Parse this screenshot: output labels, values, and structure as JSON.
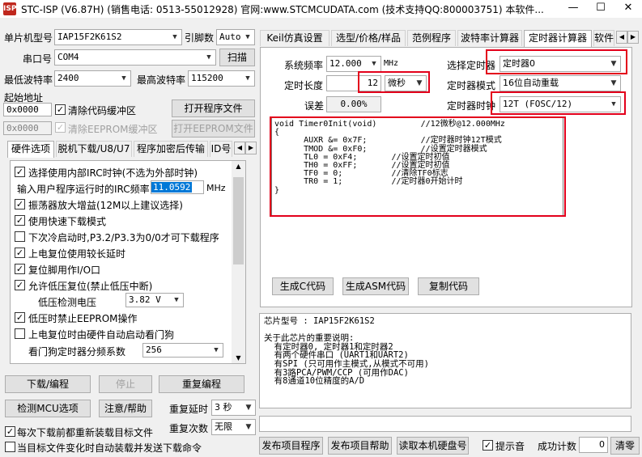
{
  "window": {
    "title": "STC-ISP (V6.87H) (销售电话: 0513-55012928) 官网:www.STCMCUDATA.com  (技术支持QQ:800003751) 本软件...",
    "minimize": "—",
    "maximize": "☐",
    "close": "✕"
  },
  "left": {
    "mcu_label": "单片机型号",
    "mcu_value": "IAP15F2K61S2",
    "pins_label": "引脚数",
    "pins_value": "Auto",
    "port_label": "串口号",
    "port_value": "COM4",
    "scan_button": "扫描",
    "min_baud_label": "最低波特率",
    "min_baud_value": "2400",
    "max_baud_label": "最高波特率",
    "max_baud_value": "115200",
    "start_addr_label": "起始地址",
    "addr1": "0x0000",
    "clear_code_label": "清除代码缓冲区",
    "open_program_button": "打开程序文件",
    "addr2": "0x0000",
    "clear_eeprom_label": "清除EEPROM缓冲区",
    "open_eeprom_button": "打开EEPROM文件",
    "tabs": [
      "硬件选项",
      "脱机下载/U8/U7",
      "程序加密后传输",
      "ID号"
    ],
    "options": [
      {
        "text": "选择使用内部IRC时钟(不选为外部时钟)",
        "checked": true
      },
      {
        "text": "输入用户程序运行时的IRC频率",
        "checked": null
      },
      {
        "text": "振荡器放大增益(12M以上建议选择)",
        "checked": true
      },
      {
        "text": "使用快速下载模式",
        "checked": true
      },
      {
        "text": "下次冷启动时,P3.2/P3.3为0/0才可下载程序",
        "checked": false
      },
      {
        "text": "上电复位使用较长延时",
        "checked": true
      },
      {
        "text": "复位脚用作I/O口",
        "checked": true
      },
      {
        "text": "允许低压复位(禁止低压中断)",
        "checked": true
      },
      {
        "text": "低压检测电压",
        "checked": null
      },
      {
        "text": "低压时禁止EEPROM操作",
        "checked": true
      },
      {
        "text": "上电复位时由硬件自动启动看门狗",
        "checked": false
      },
      {
        "text": "看门狗定时器分频系数",
        "checked": null
      }
    ],
    "irc_freq": "11.0592",
    "irc_unit": "MHz",
    "lvd_value": "3.82 V",
    "wdt_value": "256",
    "download_button": "下载/编程",
    "stop_button": "停止",
    "reprogram_button": "重复编程",
    "check_mcu_button": "检测MCU选项",
    "help_button": "注意/帮助",
    "repeat_delay_label": "重复延时",
    "repeat_delay_value": "3 秒",
    "repeat_count_label": "重复次数",
    "repeat_count_value": "无限",
    "reload_each_label": "每次下载前都重新装载目标文件",
    "auto_reload_label": "当目标文件变化时自动装载并发送下载命令"
  },
  "right": {
    "tabs": [
      "Keil仿真设置",
      "选型/价格/样品",
      "范例程序",
      "波特率计算器",
      "定时器计算器",
      "软件"
    ],
    "sys_freq_label": "系统频率",
    "sys_freq_value": "12.000",
    "sys_freq_unit": "MHz",
    "select_timer_label": "选择定时器",
    "select_timer_value": "定时器0",
    "timer_len_label": "定时长度",
    "timer_len_value": "12",
    "timer_len_unit": "微秒",
    "timer_mode_label": "定时器模式",
    "timer_mode_value": "16位自动重载",
    "error_label": "误差",
    "error_value": "0.00%",
    "timer_clock_label": "定时器时钟",
    "timer_clock_value": "12T (FOSC/12)",
    "code_lines": [
      "void Timer0Init(void)\t\t//12微秒@12.000MHz",
      "{",
      "\tAUXR &= 0x7F;\t\t//定时器时钟12T模式",
      "\tTMOD &= 0xF0;\t\t//设置定时器模式",
      "\tTL0 = 0xF4;\t\t//设置定时初值",
      "\tTH0 = 0xFF;\t\t//设置定时初值",
      "\tTF0 = 0;\t\t//清除TF0标志",
      "\tTR0 = 1;\t\t//定时器0开始计时",
      "}"
    ],
    "gen_c_button": "生成C代码",
    "gen_asm_button": "生成ASM代码",
    "copy_code_button": "复制代码",
    "chip_info": "芯片型号 : IAP15F2K61S2\n\n关于此芯片的重要说明:\n  有定时器0, 定时器1和定时器2\n  有两个硬件串口 (UART1和UART2)\n  有SPI (只可用作主模式,从模式不可用)\n  有3路PCA/PWM/CCP (可用作DAC)\n  有8通道10位精度的A/D",
    "publish_program_button": "发布项目程序",
    "publish_help_button": "发布项目帮助",
    "read_serial_button": "读取本机硬盘号",
    "tone_label": "提示音",
    "success_count_label": "成功计数",
    "success_count_value": "0",
    "clear_button": "清零"
  }
}
